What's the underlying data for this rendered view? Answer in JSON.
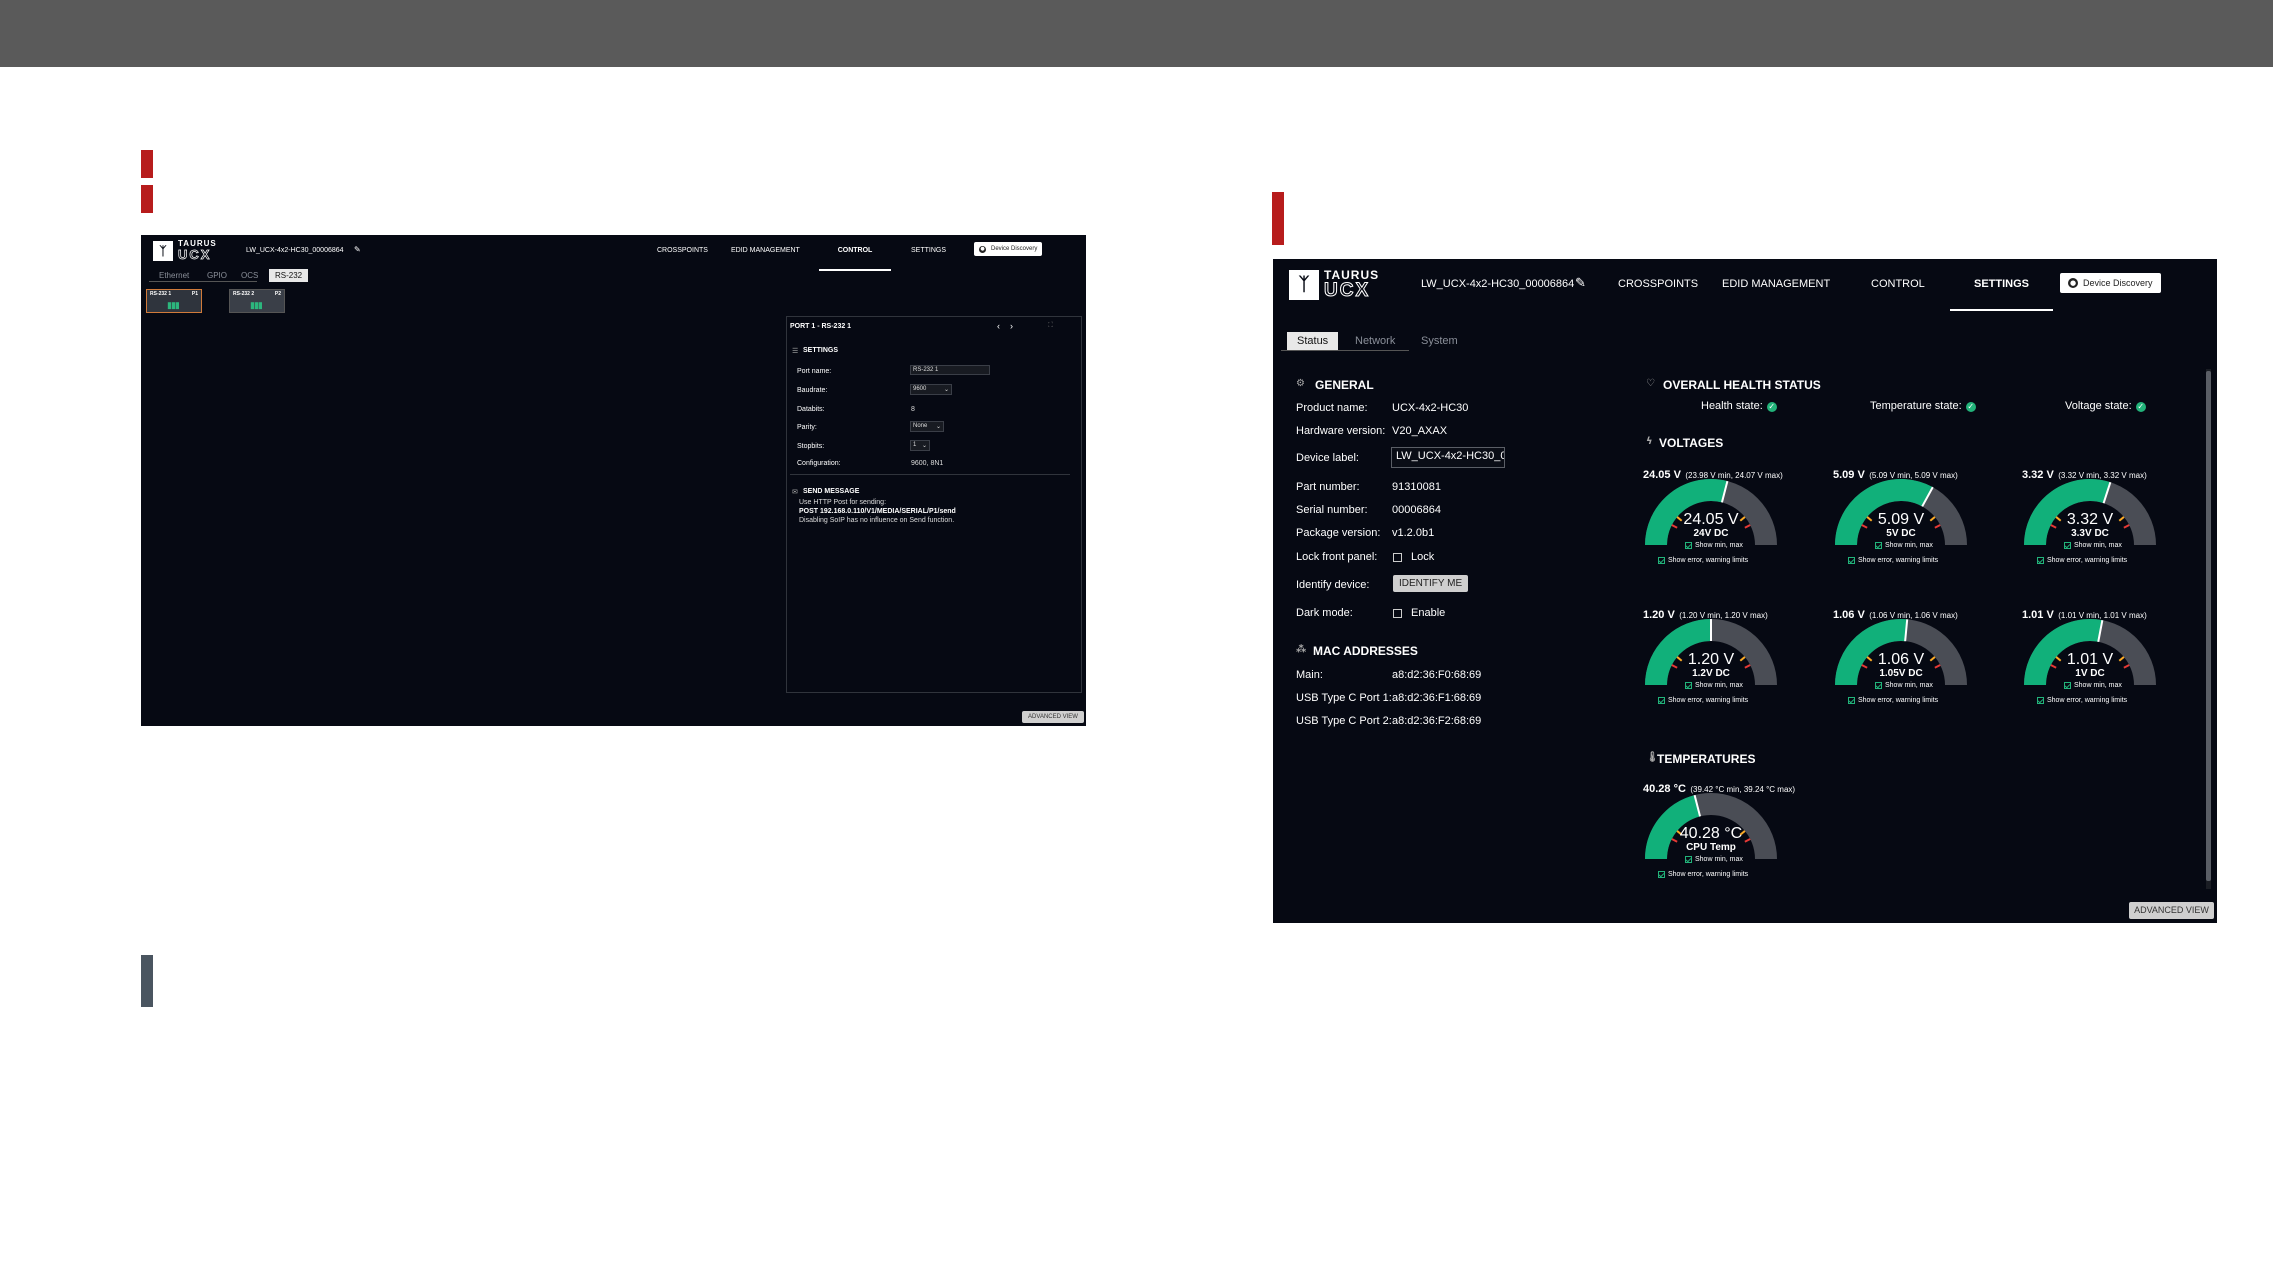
{
  "left_app": {
    "device_name": "LW_UCX-4x2-HC30_00006864",
    "nav": [
      "CROSSPOINTS",
      "EDID MANAGEMENT",
      "CONTROL",
      "SETTINGS"
    ],
    "discovery": "Device Discovery",
    "tabs": [
      "Ethernet",
      "GPIO",
      "OCS",
      "RS-232"
    ],
    "ports": [
      {
        "label": "RS-232 1",
        "tag": "P1"
      },
      {
        "label": "RS-232 2",
        "tag": "P2"
      }
    ],
    "panel_title": "PORT 1 - RS-232 1",
    "settings_title": "SETTINGS",
    "settings": [
      {
        "key": "Port name:",
        "value": "RS-232 1"
      },
      {
        "key": "Baudrate:",
        "value": "9600"
      },
      {
        "key": "Databits:",
        "value": "8"
      },
      {
        "key": "Parity:",
        "value": "None"
      },
      {
        "key": "Stopbits:",
        "value": "1"
      },
      {
        "key": "Configuration:",
        "value": "9600, 8N1"
      }
    ],
    "send_title": "SEND MESSAGE",
    "send_lines": [
      "Use HTTP Post for sending:",
      "POST 192.168.0.110/V1/MEDIA/SERIAL/P1/send",
      "Disabling SoIP has no influence on Send function."
    ],
    "advanced": "ADVANCED VIEW"
  },
  "right_app": {
    "device_name": "LW_UCX-4x2-HC30_00006864",
    "nav": [
      "CROSSPOINTS",
      "EDID MANAGEMENT",
      "CONTROL",
      "SETTINGS"
    ],
    "discovery": "Device Discovery",
    "tabs": [
      "Status",
      "Network",
      "System"
    ],
    "general_title": "GENERAL",
    "general": [
      {
        "key": "Product name:",
        "value": "UCX-4x2-HC30"
      },
      {
        "key": "Hardware version:",
        "value": "V20_AXAX"
      },
      {
        "key": "Device label:",
        "value": "LW_UCX-4x2-HC30_0"
      },
      {
        "key": "Part number:",
        "value": "91310081"
      },
      {
        "key": "Serial number:",
        "value": "00006864"
      },
      {
        "key": "Package version:",
        "value": "v1.2.0b1"
      },
      {
        "key": "Lock front panel:",
        "value": "Lock"
      },
      {
        "key": "Identify device:",
        "value": "IDENTIFY ME"
      },
      {
        "key": "Dark mode:",
        "value": "Enable"
      }
    ],
    "mac_title": "MAC ADDRESSES",
    "mac": [
      {
        "key": "Main:",
        "value": "a8:d2:36:F0:68:69"
      },
      {
        "key": "USB Type C Port 1:",
        "value": "a8:d2:36:F1:68:69"
      },
      {
        "key": "USB Type C Port 2:",
        "value": "a8:d2:36:F2:68:69"
      }
    ],
    "health_title": "OVERALL HEALTH STATUS",
    "health": [
      "Health state:",
      "Temperature state:",
      "Voltage state:"
    ],
    "voltages_title": "VOLTAGES",
    "voltages": [
      {
        "head": "24.05 V",
        "range": "(23.98 V min, 24.07 V max)",
        "value": "24.05 V",
        "label": "24V DC",
        "fraction": 0.58
      },
      {
        "head": "5.09 V",
        "range": "(5.09 V min, 5.09 V max)",
        "value": "5.09 V",
        "label": "5V DC",
        "fraction": 0.66
      },
      {
        "head": "3.32 V",
        "range": "(3.32 V min, 3.32 V max)",
        "value": "3.32 V",
        "label": "3.3V DC",
        "fraction": 0.6
      },
      {
        "head": "1.20 V",
        "range": "(1.20 V min, 1.20 V max)",
        "value": "1.20 V",
        "label": "1.2V DC",
        "fraction": 0.5
      },
      {
        "head": "1.06 V",
        "range": "(1.06 V min, 1.06 V max)",
        "value": "1.06 V",
        "label": "1.05V DC",
        "fraction": 0.53
      },
      {
        "head": "1.01 V",
        "range": "(1.01 V min, 1.01 V max)",
        "value": "1.01 V",
        "label": "1V DC",
        "fraction": 0.56
      }
    ],
    "temps_title": "TEMPERATURES",
    "temps": [
      {
        "head": "40.28 °C",
        "range": "(39.42 °C min, 39.24 °C max)",
        "value": "40.28 °C",
        "label": "CPU Temp",
        "fraction": 0.42
      }
    ],
    "show_min_max": "Show min, max",
    "show_limits": "Show error, warning limits",
    "advanced": "ADVANCED VIEW"
  }
}
